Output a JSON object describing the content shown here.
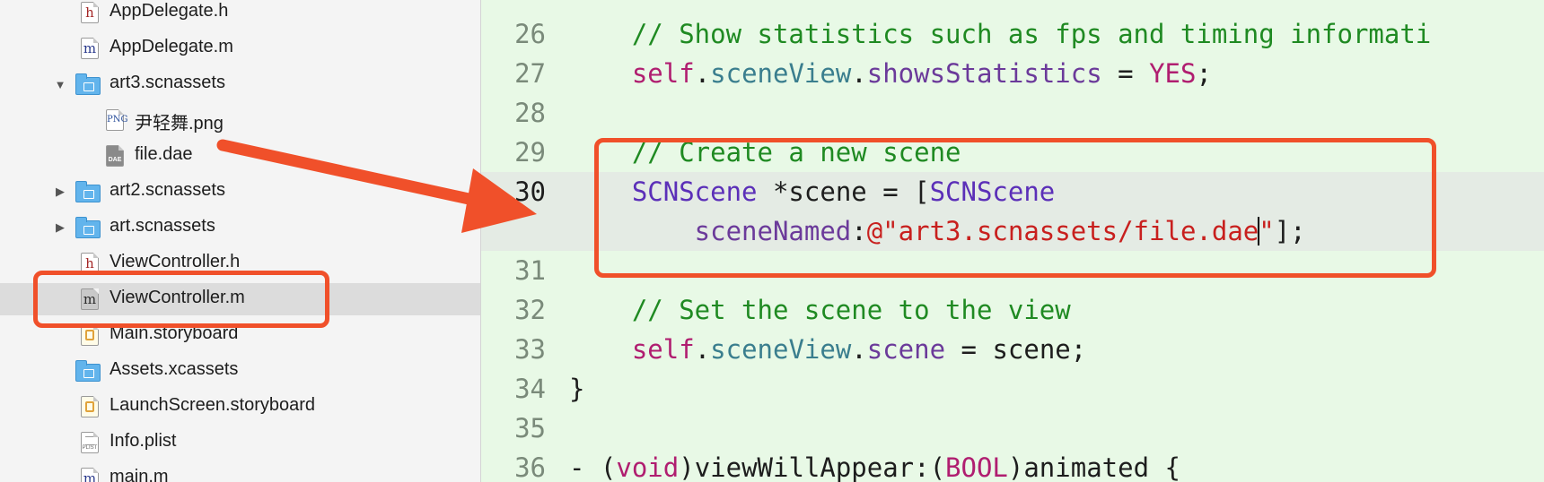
{
  "navigator": {
    "items": [
      {
        "label": "AppDelegate.h",
        "icon": "header-file-icon",
        "glyph": "h"
      },
      {
        "label": "AppDelegate.m",
        "icon": "objc-file-icon",
        "glyph": "m"
      },
      {
        "label": "art3.scnassets",
        "icon": "folder-icon",
        "disclosure": "▼"
      },
      {
        "label": "尹轻舞.png",
        "icon": "image-file-icon",
        "glyph": "PNG"
      },
      {
        "label": "file.dae",
        "icon": "dae-file-icon",
        "glyph": "DAE"
      },
      {
        "label": "art2.scnassets",
        "icon": "folder-icon",
        "disclosure": "▶"
      },
      {
        "label": "art.scnassets",
        "icon": "folder-icon",
        "disclosure": "▶"
      },
      {
        "label": "ViewController.h",
        "icon": "header-file-icon",
        "glyph": "h"
      },
      {
        "label": "ViewController.m",
        "icon": "objc-file-icon",
        "glyph": "m"
      },
      {
        "label": "Main.storyboard",
        "icon": "storyboard-file-icon"
      },
      {
        "label": "Assets.xcassets",
        "icon": "folder-icon"
      },
      {
        "label": "LaunchScreen.storyboard",
        "icon": "storyboard-file-icon"
      },
      {
        "label": "Info.plist",
        "icon": "plist-file-icon",
        "glyph": "PLIST"
      },
      {
        "label": "main.m",
        "icon": "objc-file-icon",
        "glyph": "m"
      }
    ]
  },
  "editor": {
    "lines": [
      {
        "no": "26",
        "tokens": [
          [
            "k-comment",
            "    // Show statistics such as fps and timing informati"
          ]
        ]
      },
      {
        "no": "27",
        "tokens": [
          [
            "k-self",
            "    self"
          ],
          [
            "",
            "."
          ],
          [
            "k-prop",
            "sceneView"
          ],
          [
            "",
            "."
          ],
          [
            "k-method",
            "showsStatistics"
          ],
          [
            "",
            " = "
          ],
          [
            "k-yes",
            "YES"
          ],
          [
            "",
            ";"
          ]
        ]
      },
      {
        "no": "28",
        "tokens": []
      },
      {
        "no": "29",
        "tokens": [
          [
            "k-comment",
            "    // Create a new scene"
          ]
        ]
      },
      {
        "no": "30",
        "tokens": [
          [
            "k-class",
            "    SCNScene"
          ],
          [
            "",
            " *scene = ["
          ],
          [
            "k-class",
            "SCNScene"
          ]
        ]
      },
      {
        "no": "",
        "tokens": [
          [
            "k-method",
            "        sceneNamed"
          ],
          [
            "",
            ":"
          ],
          [
            "k-string",
            "@\"art3.scnassets/file.dae"
          ],
          [
            "cursor",
            ""
          ],
          [
            "k-string",
            "\""
          ],
          [
            "",
            "];"
          ]
        ]
      },
      {
        "no": "31",
        "tokens": []
      },
      {
        "no": "32",
        "tokens": [
          [
            "k-comment",
            "    // Set the scene to the view"
          ]
        ]
      },
      {
        "no": "33",
        "tokens": [
          [
            "k-self",
            "    self"
          ],
          [
            "",
            "."
          ],
          [
            "k-prop",
            "sceneView"
          ],
          [
            "",
            "."
          ],
          [
            "k-method",
            "scene"
          ],
          [
            "",
            " = scene;"
          ]
        ]
      },
      {
        "no": "34",
        "tokens": [
          [
            "",
            "}"
          ]
        ]
      },
      {
        "no": "35",
        "tokens": []
      },
      {
        "no": "36",
        "tokens": [
          [
            "",
            "- ("
          ],
          [
            "k-type",
            "void"
          ],
          [
            "",
            ")viewWillAppear:("
          ],
          [
            "k-type",
            "BOOL"
          ],
          [
            "",
            ")animated {"
          ]
        ]
      }
    ]
  },
  "annotation": {
    "color": "#f0502a"
  }
}
